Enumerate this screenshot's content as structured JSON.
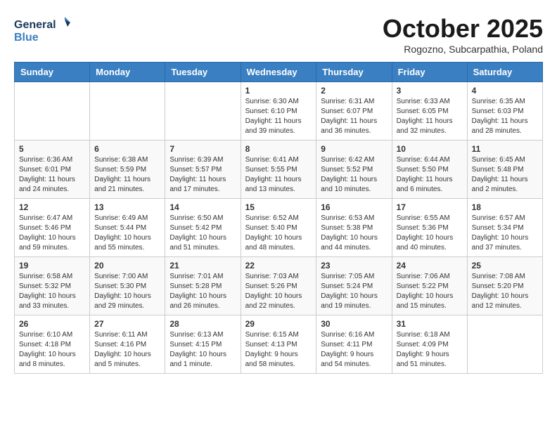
{
  "header": {
    "logo_line1": "General",
    "logo_line2": "Blue",
    "month": "October 2025",
    "location": "Rogozno, Subcarpathia, Poland"
  },
  "weekdays": [
    "Sunday",
    "Monday",
    "Tuesday",
    "Wednesday",
    "Thursday",
    "Friday",
    "Saturday"
  ],
  "weeks": [
    [
      {
        "day": "",
        "info": ""
      },
      {
        "day": "",
        "info": ""
      },
      {
        "day": "",
        "info": ""
      },
      {
        "day": "1",
        "info": "Sunrise: 6:30 AM\nSunset: 6:10 PM\nDaylight: 11 hours\nand 39 minutes."
      },
      {
        "day": "2",
        "info": "Sunrise: 6:31 AM\nSunset: 6:07 PM\nDaylight: 11 hours\nand 36 minutes."
      },
      {
        "day": "3",
        "info": "Sunrise: 6:33 AM\nSunset: 6:05 PM\nDaylight: 11 hours\nand 32 minutes."
      },
      {
        "day": "4",
        "info": "Sunrise: 6:35 AM\nSunset: 6:03 PM\nDaylight: 11 hours\nand 28 minutes."
      }
    ],
    [
      {
        "day": "5",
        "info": "Sunrise: 6:36 AM\nSunset: 6:01 PM\nDaylight: 11 hours\nand 24 minutes."
      },
      {
        "day": "6",
        "info": "Sunrise: 6:38 AM\nSunset: 5:59 PM\nDaylight: 11 hours\nand 21 minutes."
      },
      {
        "day": "7",
        "info": "Sunrise: 6:39 AM\nSunset: 5:57 PM\nDaylight: 11 hours\nand 17 minutes."
      },
      {
        "day": "8",
        "info": "Sunrise: 6:41 AM\nSunset: 5:55 PM\nDaylight: 11 hours\nand 13 minutes."
      },
      {
        "day": "9",
        "info": "Sunrise: 6:42 AM\nSunset: 5:52 PM\nDaylight: 11 hours\nand 10 minutes."
      },
      {
        "day": "10",
        "info": "Sunrise: 6:44 AM\nSunset: 5:50 PM\nDaylight: 11 hours\nand 6 minutes."
      },
      {
        "day": "11",
        "info": "Sunrise: 6:45 AM\nSunset: 5:48 PM\nDaylight: 11 hours\nand 2 minutes."
      }
    ],
    [
      {
        "day": "12",
        "info": "Sunrise: 6:47 AM\nSunset: 5:46 PM\nDaylight: 10 hours\nand 59 minutes."
      },
      {
        "day": "13",
        "info": "Sunrise: 6:49 AM\nSunset: 5:44 PM\nDaylight: 10 hours\nand 55 minutes."
      },
      {
        "day": "14",
        "info": "Sunrise: 6:50 AM\nSunset: 5:42 PM\nDaylight: 10 hours\nand 51 minutes."
      },
      {
        "day": "15",
        "info": "Sunrise: 6:52 AM\nSunset: 5:40 PM\nDaylight: 10 hours\nand 48 minutes."
      },
      {
        "day": "16",
        "info": "Sunrise: 6:53 AM\nSunset: 5:38 PM\nDaylight: 10 hours\nand 44 minutes."
      },
      {
        "day": "17",
        "info": "Sunrise: 6:55 AM\nSunset: 5:36 PM\nDaylight: 10 hours\nand 40 minutes."
      },
      {
        "day": "18",
        "info": "Sunrise: 6:57 AM\nSunset: 5:34 PM\nDaylight: 10 hours\nand 37 minutes."
      }
    ],
    [
      {
        "day": "19",
        "info": "Sunrise: 6:58 AM\nSunset: 5:32 PM\nDaylight: 10 hours\nand 33 minutes."
      },
      {
        "day": "20",
        "info": "Sunrise: 7:00 AM\nSunset: 5:30 PM\nDaylight: 10 hours\nand 29 minutes."
      },
      {
        "day": "21",
        "info": "Sunrise: 7:01 AM\nSunset: 5:28 PM\nDaylight: 10 hours\nand 26 minutes."
      },
      {
        "day": "22",
        "info": "Sunrise: 7:03 AM\nSunset: 5:26 PM\nDaylight: 10 hours\nand 22 minutes."
      },
      {
        "day": "23",
        "info": "Sunrise: 7:05 AM\nSunset: 5:24 PM\nDaylight: 10 hours\nand 19 minutes."
      },
      {
        "day": "24",
        "info": "Sunrise: 7:06 AM\nSunset: 5:22 PM\nDaylight: 10 hours\nand 15 minutes."
      },
      {
        "day": "25",
        "info": "Sunrise: 7:08 AM\nSunset: 5:20 PM\nDaylight: 10 hours\nand 12 minutes."
      }
    ],
    [
      {
        "day": "26",
        "info": "Sunrise: 6:10 AM\nSunset: 4:18 PM\nDaylight: 10 hours\nand 8 minutes."
      },
      {
        "day": "27",
        "info": "Sunrise: 6:11 AM\nSunset: 4:16 PM\nDaylight: 10 hours\nand 5 minutes."
      },
      {
        "day": "28",
        "info": "Sunrise: 6:13 AM\nSunset: 4:15 PM\nDaylight: 10 hours\nand 1 minute."
      },
      {
        "day": "29",
        "info": "Sunrise: 6:15 AM\nSunset: 4:13 PM\nDaylight: 9 hours\nand 58 minutes."
      },
      {
        "day": "30",
        "info": "Sunrise: 6:16 AM\nSunset: 4:11 PM\nDaylight: 9 hours\nand 54 minutes."
      },
      {
        "day": "31",
        "info": "Sunrise: 6:18 AM\nSunset: 4:09 PM\nDaylight: 9 hours\nand 51 minutes."
      },
      {
        "day": "",
        "info": ""
      }
    ]
  ]
}
